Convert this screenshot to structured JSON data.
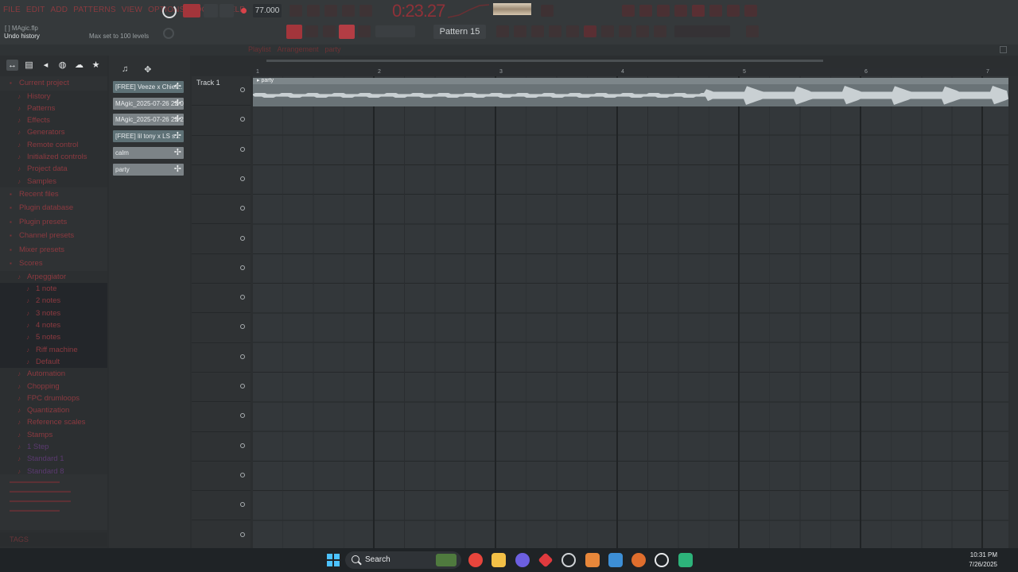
{
  "menu": [
    "FILE",
    "EDIT",
    "ADD",
    "PATTERNS",
    "VIEW",
    "OPTIONS",
    "TOOLS",
    "HELP"
  ],
  "hint": {
    "file": "[ ] MAgic.flp",
    "title": "Undo history",
    "max": "Max set to 100 levels"
  },
  "transport": {
    "tempo": "77.000",
    "time": "0:23.27"
  },
  "pattern_selector": "Pattern 15",
  "subbar": {
    "playlist": "Playlist",
    "arrangement": "Arrangement",
    "current": "party"
  },
  "browser": {
    "items": [
      {
        "label": "Current project",
        "kind": "top"
      },
      {
        "label": "History",
        "kind": "child"
      },
      {
        "label": "Patterns",
        "kind": "child"
      },
      {
        "label": "Effects",
        "kind": "child"
      },
      {
        "label": "Generators",
        "kind": "child"
      },
      {
        "label": "Remote control",
        "kind": "child"
      },
      {
        "label": "Initialized controls",
        "kind": "child"
      },
      {
        "label": "Project data",
        "kind": "child"
      },
      {
        "label": "Samples",
        "kind": "child"
      },
      {
        "label": "Recent files",
        "kind": "top"
      },
      {
        "label": "Plugin database",
        "kind": "top"
      },
      {
        "label": "Plugin presets",
        "kind": "top"
      },
      {
        "label": "Channel presets",
        "kind": "top"
      },
      {
        "label": "Mixer presets",
        "kind": "top"
      },
      {
        "label": "Scores",
        "kind": "top"
      },
      {
        "label": "Arpeggiator",
        "kind": "child"
      },
      {
        "label": "1 note",
        "kind": "grand"
      },
      {
        "label": "2 notes",
        "kind": "grand"
      },
      {
        "label": "3 notes",
        "kind": "grand"
      },
      {
        "label": "4 notes",
        "kind": "grand"
      },
      {
        "label": "5 notes",
        "kind": "grand"
      },
      {
        "label": "Riff machine",
        "kind": "grand"
      },
      {
        "label": "Default",
        "kind": "sel"
      },
      {
        "label": "Automation",
        "kind": "child"
      },
      {
        "label": "Chopping",
        "kind": "child"
      },
      {
        "label": "FPC drumloops",
        "kind": "child"
      },
      {
        "label": "Quantization",
        "kind": "child"
      },
      {
        "label": "Reference scales",
        "kind": "child"
      },
      {
        "label": "Stamps",
        "kind": "child"
      },
      {
        "label": "1 Step",
        "kind": "dim"
      },
      {
        "label": "Standard 1",
        "kind": "dim"
      },
      {
        "label": "Standard 8",
        "kind": "dim"
      }
    ],
    "bottom_tab": "TAGS"
  },
  "clips": [
    {
      "label": "[FREE] Veeze x Chief...",
      "type": "audio"
    },
    {
      "label": "MAgic_2025-07-26 22-0...",
      "type": "pattern"
    },
    {
      "label": "MAgic_2025-07-26 22-2...",
      "type": "pattern"
    },
    {
      "label": "[FREE] lil tony x LS s...",
      "type": "audio"
    },
    {
      "label": "calm",
      "type": "pattern"
    },
    {
      "label": "party",
      "type": "pattern"
    }
  ],
  "playlist": {
    "track_label": "Track 1",
    "bars": [
      "1",
      "2",
      "3",
      "4",
      "5",
      "6",
      "7"
    ],
    "clip_name": "party"
  },
  "taskbar": {
    "search": "Search",
    "time": "10:31 PM",
    "date": "7/26/2025"
  },
  "colors": {
    "accent": "#a3353b",
    "clock": "#8f3138",
    "clip": "#6a7377"
  }
}
